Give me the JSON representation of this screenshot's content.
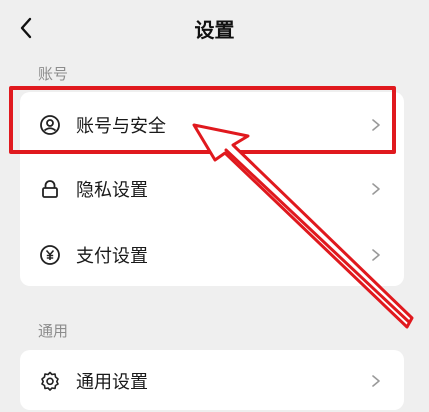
{
  "header": {
    "title": "设置",
    "back_icon": "chevron-left-icon"
  },
  "sections": [
    {
      "label": "账号",
      "items": [
        {
          "label": "账号与安全",
          "icon": "user-circle-icon"
        },
        {
          "label": "隐私设置",
          "icon": "lock-icon"
        },
        {
          "label": "支付设置",
          "icon": "yuan-circle-icon"
        }
      ]
    },
    {
      "label": "通用",
      "items": [
        {
          "label": "通用设置",
          "icon": "gear-icon"
        }
      ]
    }
  ],
  "annotation": {
    "color": "#e0191e",
    "highlighted_item": "账号与安全"
  }
}
